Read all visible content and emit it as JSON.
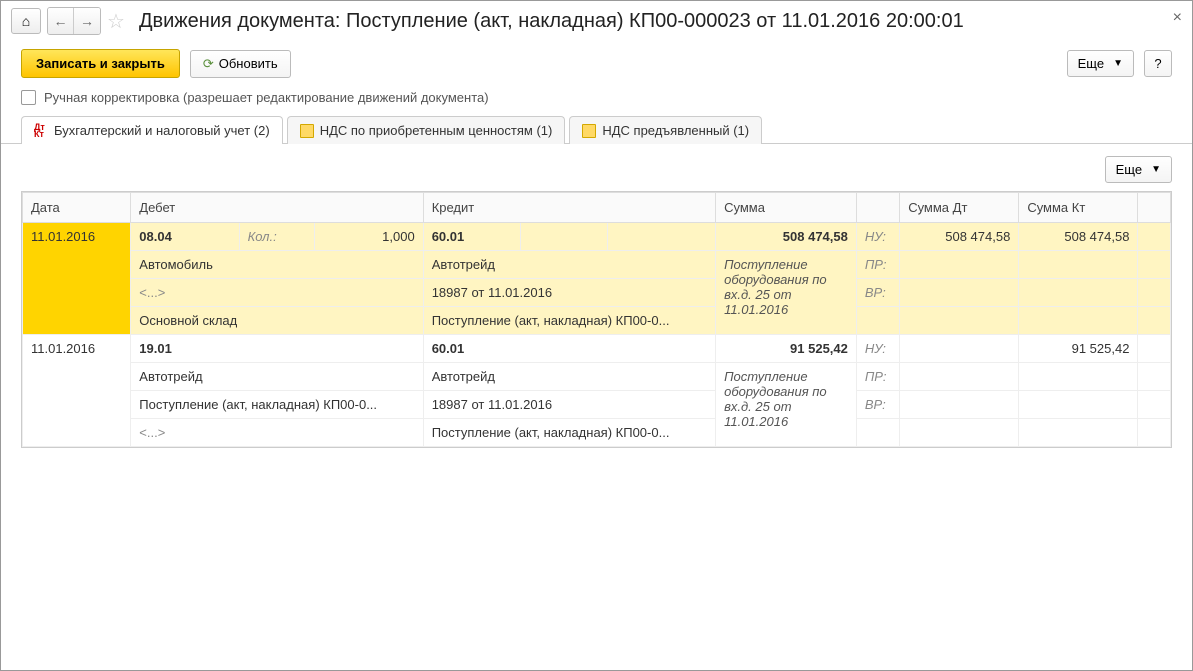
{
  "window": {
    "title": "Движения документа: Поступление (акт, накладная) КП00-000023 от 11.01.2016 20:00:01"
  },
  "actions": {
    "save_close": "Записать и закрыть",
    "refresh": "Обновить",
    "more": "Еще",
    "help": "?"
  },
  "checkbox": {
    "label": "Ручная корректировка (разрешает редактирование движений документа)"
  },
  "tabs": [
    {
      "label": "Бухгалтерский и налоговый учет (2)"
    },
    {
      "label": "НДС по приобретенным ценностям (1)"
    },
    {
      "label": "НДС предъявленный (1)"
    }
  ],
  "sub_actions": {
    "more": "Еще"
  },
  "table": {
    "headers": {
      "date": "Дата",
      "debit": "Дебет",
      "credit": "Кредит",
      "sum": "Сумма",
      "sum_dt": "Сумма Дт",
      "sum_kt": "Сумма Кт"
    },
    "rows": [
      {
        "highlighted": true,
        "date": "11.01.2016",
        "debit_acct": "08.04",
        "debit_qty_label": "Кол.:",
        "debit_qty": "1,000",
        "debit_l1": "Автомобиль",
        "debit_l2": "<...>",
        "debit_l3": "Основной склад",
        "credit_acct": "60.01",
        "credit_l1": "Автотрейд",
        "credit_l2": "18987 от 11.01.2016",
        "credit_l3": "Поступление (акт, накладная) КП00-0...",
        "sum": "508 474,58",
        "sum_note": "Поступление оборудования по вх.д. 25 от 11.01.2016",
        "tag1": "НУ:",
        "tag2": "ПР:",
        "tag3": "ВР:",
        "sum_dt": "508 474,58",
        "sum_kt": "508 474,58"
      },
      {
        "highlighted": false,
        "date": "11.01.2016",
        "debit_acct": "19.01",
        "debit_l1": "Автотрейд",
        "debit_l2": "Поступление (акт, накладная) КП00-0...",
        "debit_l3": "<...>",
        "credit_acct": "60.01",
        "credit_l1": "Автотрейд",
        "credit_l2": "18987 от 11.01.2016",
        "credit_l3": "Поступление (акт, накладная) КП00-0...",
        "sum": "91 525,42",
        "sum_note": "Поступление оборудования по вх.д. 25 от 11.01.2016",
        "tag1": "НУ:",
        "tag2": "ПР:",
        "tag3": "ВР:",
        "sum_dt": "",
        "sum_kt": "91 525,42"
      }
    ]
  }
}
